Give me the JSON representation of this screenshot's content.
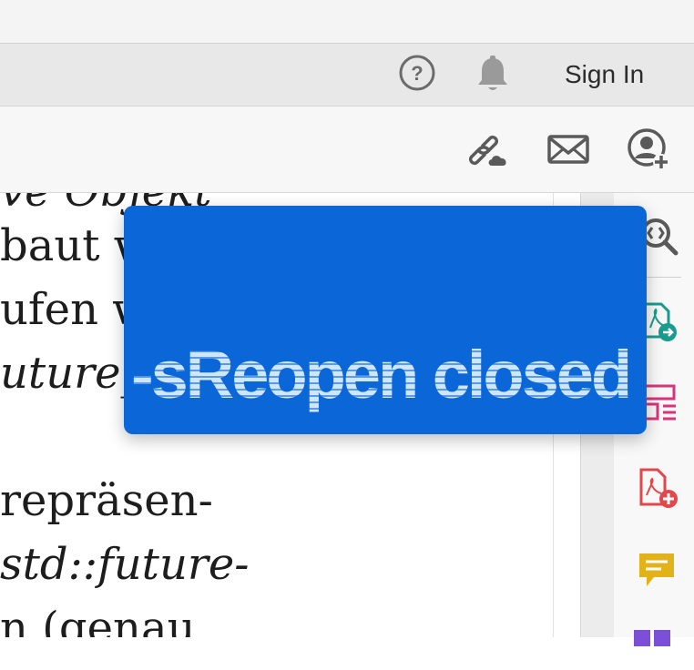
{
  "header": {
    "sign_in_label": "Sign In",
    "help_icon": "help-circle-icon",
    "notifications_icon": "bell-icon"
  },
  "toolbar": {
    "icons": [
      "link-cloud-icon",
      "mail-icon",
      "add-user-icon"
    ]
  },
  "document": {
    "lines": [
      {
        "text": "baut w",
        "italic": false
      },
      {
        "text": "ufen w",
        "italic": false
      },
      {
        "text": "uture_e",
        "italic": true
      },
      {
        "text": "repräsen-",
        "italic": false
      },
      {
        "text": "std::future-",
        "italic": true
      },
      {
        "text": "n (genau",
        "italic": false
      }
    ],
    "partial_top_line": "ve Objekt"
  },
  "right_panel": {
    "icons": [
      "zoom-icon",
      "export-pdf-icon",
      "organize-pages-icon",
      "create-pdf-icon",
      "comment-icon",
      "more-tools-icon"
    ],
    "colors": {
      "export": "#1a9b8f",
      "organize": "#d6357a",
      "create": "#e2474b",
      "comment": "#e2b21b"
    }
  },
  "tooltip": {
    "text": "-sReopen closed XDI",
    "background": "#0b67d8"
  }
}
